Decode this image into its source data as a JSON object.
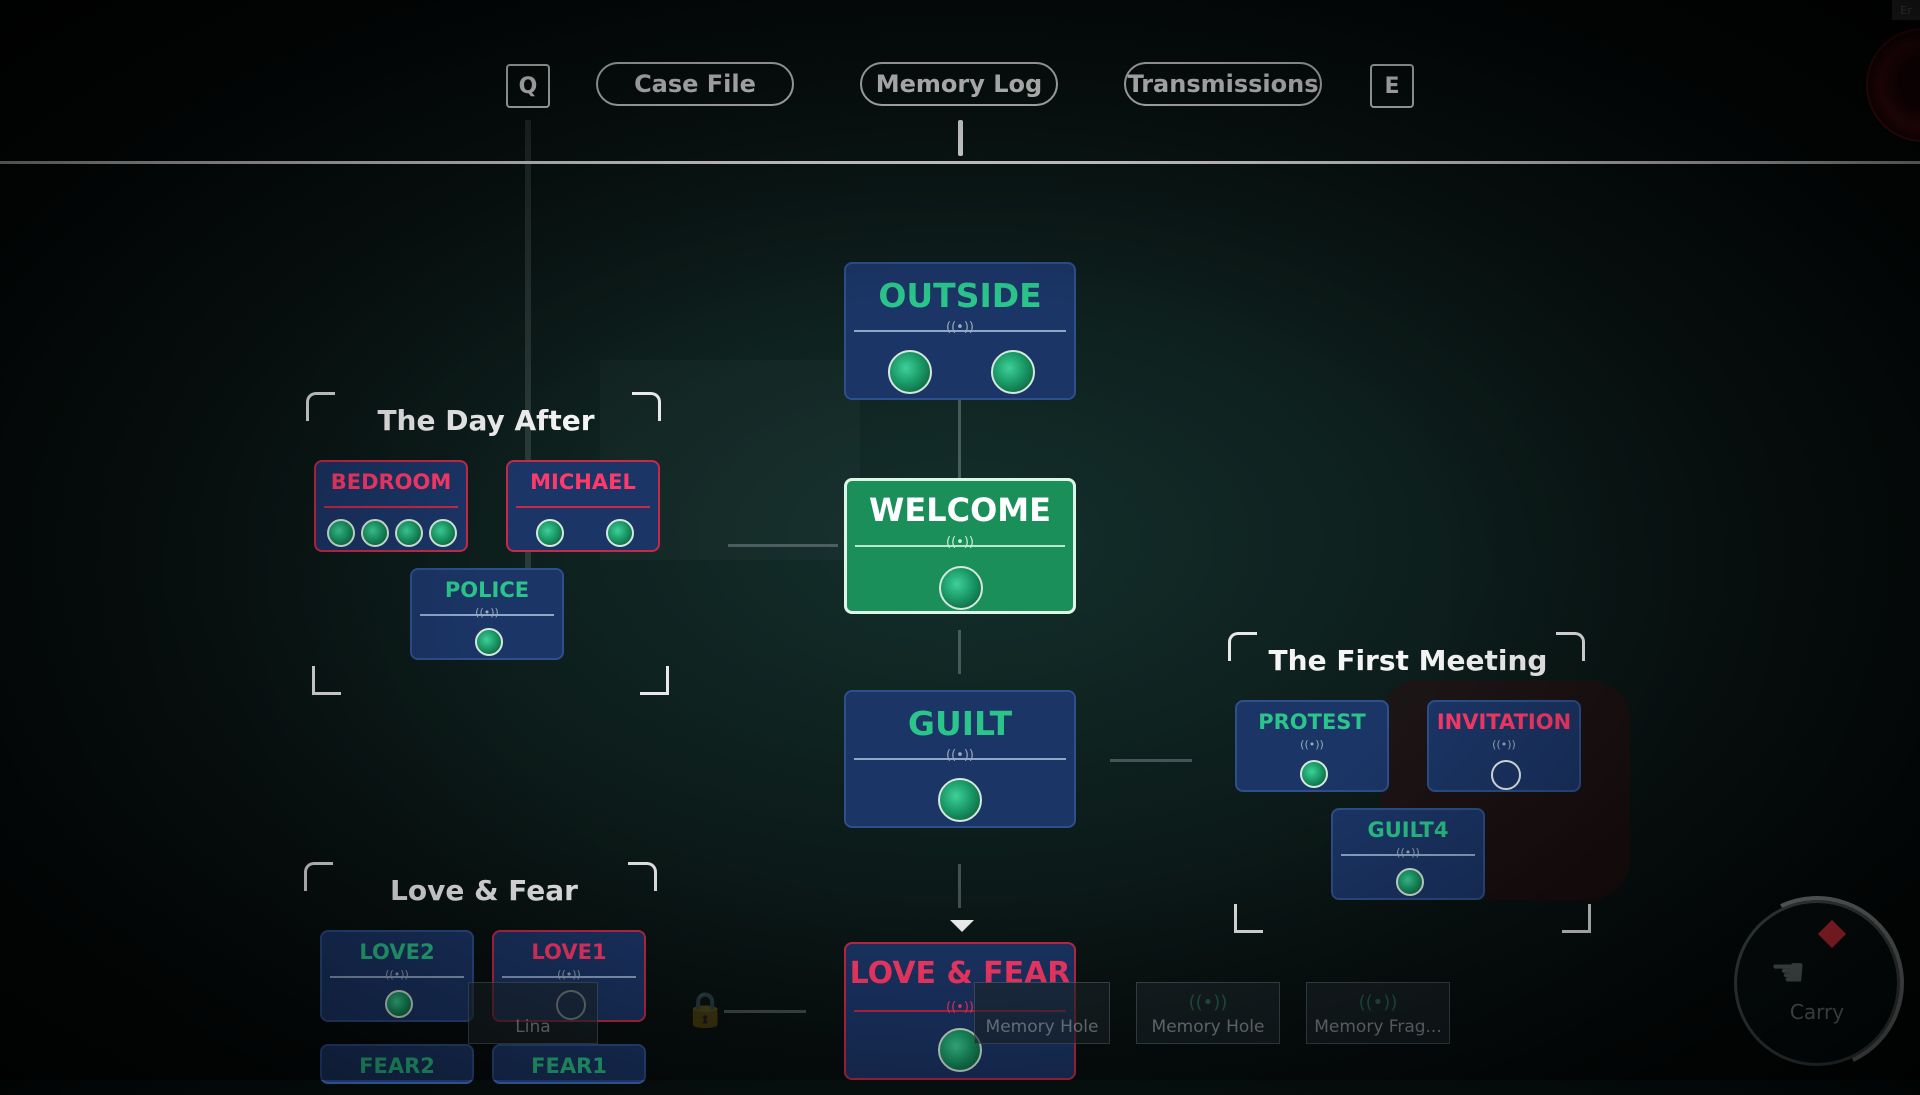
{
  "tabs": {
    "key_left": "Q",
    "key_right": "E",
    "items": [
      {
        "label": "Case File"
      },
      {
        "label": "Memory Log"
      },
      {
        "label": "Transmissions"
      }
    ]
  },
  "corner_badge": "Er",
  "main_nodes": {
    "outside": {
      "title": "OUTSIDE"
    },
    "welcome": {
      "title": "WELCOME"
    },
    "guilt": {
      "title": "GUILT"
    },
    "love_fear": {
      "title": "LOVE & FEAR"
    }
  },
  "groups": {
    "day_after": {
      "title": "The Day After",
      "nodes": {
        "bedroom": "BEDROOM",
        "michael": "MICHAEL",
        "police": "POLICE"
      }
    },
    "first_meeting": {
      "title": "The First Meeting",
      "nodes": {
        "protest": "PROTEST",
        "invitation": "INVITATION",
        "guilt4": "GUILT4"
      }
    },
    "love_fear": {
      "title": "Love & Fear",
      "nodes": {
        "love2": "LOVE2",
        "love1": "LOVE1",
        "fear2": "FEAR2",
        "fear1": "FEAR1"
      }
    }
  },
  "inventory": {
    "slots": [
      "Lina",
      "Memory Hole",
      "Memory Hole",
      "Memory Frag..."
    ]
  },
  "carry": {
    "label": "Carry"
  },
  "colors": {
    "accent_green": "#2bc48a",
    "accent_red": "#ff3a6a",
    "node_blue": "#1b3566"
  },
  "icons": [
    "signal-icon",
    "memory-orb-icon",
    "lock-icon",
    "hand-icon"
  ]
}
